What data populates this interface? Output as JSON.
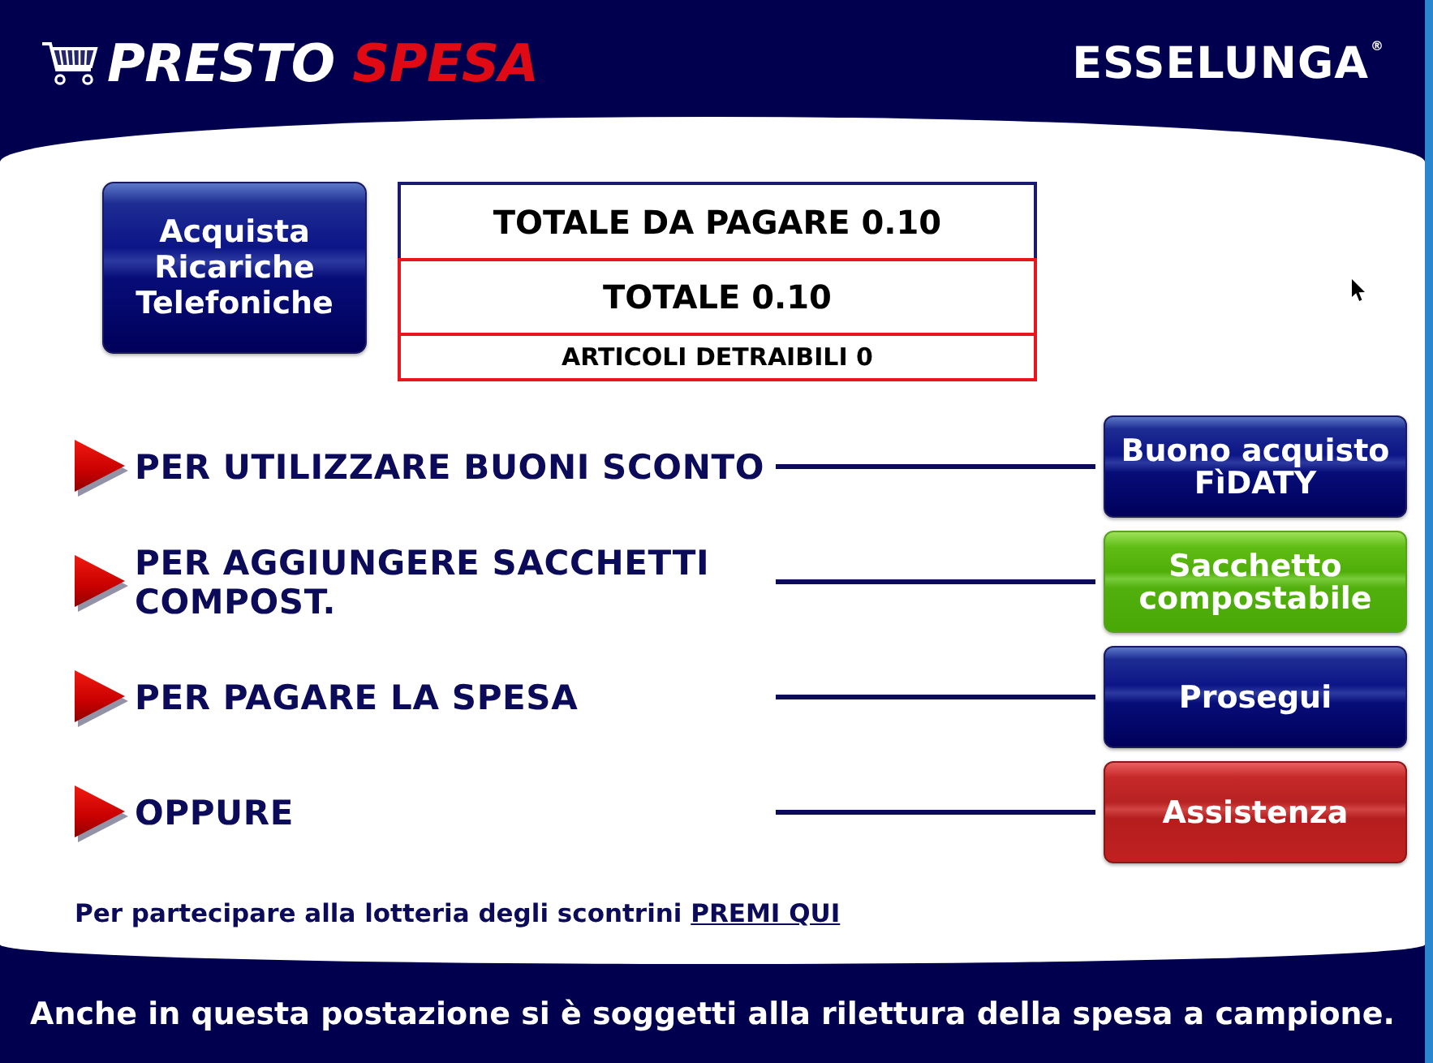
{
  "header": {
    "logo": {
      "word_1": "PRESTO",
      "word_2": "SPESA"
    },
    "brand": {
      "name": "ESSELUNGA",
      "mark": "®"
    }
  },
  "recharge_button": {
    "label": "Acquista Ricariche Telefoniche"
  },
  "totals": [
    {
      "kind": "due",
      "text": "TOTALE DA PAGARE 0.10"
    },
    {
      "kind": "total",
      "text": "TOTALE 0.10"
    },
    {
      "kind": "count",
      "text": "ARTICOLI DETRAIBILI 0"
    }
  ],
  "options": [
    {
      "label": "PER UTILIZZARE BUONI SCONTO",
      "button": {
        "label": "Buono acquisto FìDATY",
        "kind": "primary"
      }
    },
    {
      "label": "PER AGGIUNGERE SACCHETTI COMPOST.",
      "button": {
        "label": "Sacchetto compostabile",
        "kind": "eco"
      }
    },
    {
      "label": "PER PAGARE LA SPESA",
      "button": {
        "label": "Prosegui",
        "kind": "primary"
      }
    },
    {
      "label": "OPPURE",
      "button": {
        "label": "Assistenza",
        "kind": "alert"
      }
    }
  ],
  "lottery": {
    "text": "Per partecipare alla lotteria degli scontrini",
    "link": "PREMI QUI"
  },
  "footer": {
    "notice": "Anche in questa postazione si è soggetti alla rilettura della spesa a campione."
  }
}
